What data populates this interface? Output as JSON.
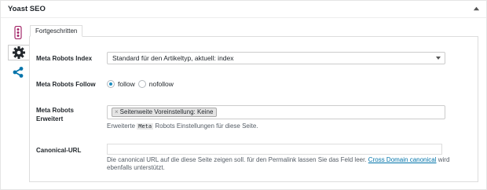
{
  "metabox": {
    "title": "Yoast SEO",
    "accent": "#0073aa"
  },
  "side_tabs": [
    {
      "name": "traffic-light-icon"
    },
    {
      "name": "gear-icon",
      "active": true
    },
    {
      "name": "share-icon"
    }
  ],
  "panel": {
    "tab_label": "Fortgeschritten"
  },
  "robots_index": {
    "label": "Meta Robots Index",
    "value": "Standard für den Artikeltyp, aktuell: index"
  },
  "robots_follow": {
    "label": "Meta Robots Follow",
    "options": [
      "follow",
      "nofollow"
    ],
    "selected": "follow"
  },
  "robots_advanced": {
    "label": "Meta Robots Erweitert",
    "chip": "Seitenweite Voreinstellung: Keine",
    "chip_remove": "×",
    "help_before": "Erweiterte",
    "help_code": "Meta",
    "help_after": "Robots Einstellungen für diese Seite."
  },
  "canonical": {
    "label": "Canonical-URL",
    "value": "",
    "help_text": "Die canonical URL auf die diese Seite zeigen soll. für den Permalink lassen Sie das Feld leer.",
    "help_link": "Cross Domain canonical",
    "help_tail": "wird ebenfalls unterstützt."
  }
}
